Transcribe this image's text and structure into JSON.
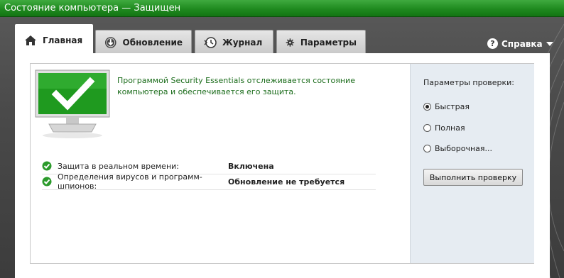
{
  "window": {
    "title": "Состояние компьютера — Защищен"
  },
  "tabs": [
    {
      "label": "Главная",
      "icon": "home-icon",
      "active": true
    },
    {
      "label": "Обновление",
      "icon": "update-icon",
      "active": false
    },
    {
      "label": "Журнал",
      "icon": "history-icon",
      "active": false
    },
    {
      "label": "Параметры",
      "icon": "gear-icon",
      "active": false
    }
  ],
  "help": {
    "label": "Справка",
    "icon": "help-icon"
  },
  "status": {
    "message": "Программой Security Essentials отслеживается состояние компьютера и обеспечивается его защита.",
    "accent": "#1e8a1e",
    "items": [
      {
        "label": "Защита в реальном времени:",
        "value": "Включена"
      },
      {
        "label": "Определения вирусов и программ-шпионов:",
        "value": "Обновление не требуется"
      }
    ]
  },
  "scan": {
    "title": "Параметры проверки:",
    "options": [
      {
        "label": "Быстрая",
        "selected": true
      },
      {
        "label": "Полная",
        "selected": false
      },
      {
        "label": "Выборочная...",
        "selected": false
      }
    ],
    "button": "Выполнить проверку"
  }
}
